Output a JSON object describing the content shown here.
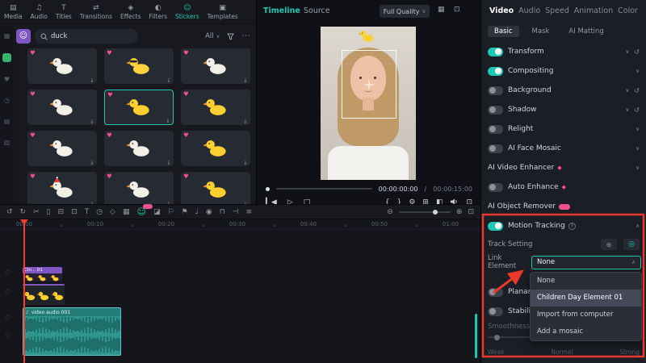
{
  "colors": {
    "accent": "#1fc8b2",
    "annotation_red": "#e8392c",
    "badge_pink": "#f0508c",
    "sticker_clip_purple": "#7e57c2",
    "audio_clip_teal": "#2f968f"
  },
  "media_toolbar": {
    "items": [
      {
        "id": "media",
        "label": "Media"
      },
      {
        "id": "audio",
        "label": "Audio"
      },
      {
        "id": "titles",
        "label": "Titles"
      },
      {
        "id": "transitions",
        "label": "Transitions"
      },
      {
        "id": "effects",
        "label": "Effects"
      },
      {
        "id": "filters",
        "label": "Filters"
      },
      {
        "id": "stickers",
        "label": "Stickers",
        "active": true
      },
      {
        "id": "templates",
        "label": "Templates"
      }
    ]
  },
  "sticker_panel": {
    "search": {
      "value": "duck"
    },
    "filter_all_label": "All",
    "more_label": "···",
    "stickers": [
      {
        "name": "white-duck",
        "color": "#f2efe6"
      },
      {
        "name": "sunglasses-duck",
        "color": "#ffd23e",
        "accessory": "sunglasses"
      },
      {
        "name": "white-duckling",
        "color": "#f2efe6"
      },
      {
        "name": "dancing-goose",
        "color": "#f2efe6"
      },
      {
        "name": "yellow-duck",
        "color": "#ffcf2f",
        "selected": true
      },
      {
        "name": "rubber-duck",
        "color": "#ffcf2f"
      },
      {
        "name": "swan-pair",
        "color": "#f2efe6"
      },
      {
        "name": "white-goose",
        "color": "#f2efe6"
      },
      {
        "name": "umbrella-duck",
        "color": "#ffcf2f"
      },
      {
        "name": "santa-duck",
        "color": "#f2efe6",
        "accessory": "hat"
      },
      {
        "name": "white-swan",
        "color": "#f2efe6"
      },
      {
        "name": "yellow-duckling",
        "color": "#ffcf2f"
      }
    ]
  },
  "preview": {
    "tabs": [
      {
        "label": "Timeline",
        "active": true
      },
      {
        "label": "Source",
        "active": false
      }
    ],
    "quality_label": "Full Quality",
    "header_icons": [
      "grid-view",
      "expand-view"
    ],
    "timecode_current": "00:00:00:00",
    "timecode_separator": "/",
    "timecode_total": "00:00:15:00",
    "player_left": [
      "skip-back",
      "play",
      "stop"
    ],
    "player_right": [
      "brace-in",
      "brace-out",
      "settings",
      "expand",
      "compare",
      "volume",
      "fullscreen"
    ]
  },
  "properties": {
    "tabs": [
      {
        "label": "Video",
        "active": true
      },
      {
        "label": "Audio"
      },
      {
        "label": "Speed"
      },
      {
        "label": "Animation"
      },
      {
        "label": "Color"
      }
    ],
    "sub_tabs": [
      {
        "label": "Basic",
        "active": true
      },
      {
        "label": "Mask"
      },
      {
        "label": "AI Matting"
      }
    ],
    "rows": [
      {
        "id": "transform",
        "label": "Transform",
        "toggle": "on",
        "chevron": true,
        "reset": true
      },
      {
        "id": "compositing",
        "label": "Compositing",
        "toggle": "on",
        "chevron": true,
        "reset": false
      },
      {
        "id": "background",
        "label": "Background",
        "toggle": "off",
        "chevron": true,
        "reset": true
      },
      {
        "id": "shadow",
        "label": "Shadow",
        "toggle": "off",
        "chevron": true,
        "reset": true
      },
      {
        "id": "relight",
        "label": "Relight",
        "toggle": "off",
        "chevron": true,
        "reset": false
      },
      {
        "id": "ai-face-mosaic",
        "label": "AI Face Mosaic",
        "toggle": "off",
        "chevron": true,
        "reset": false
      },
      {
        "id": "ai-video-enhancer",
        "label": "AI Video Enhancer",
        "toggle": "none",
        "badge": "diamond",
        "chevron": true,
        "reset": false
      },
      {
        "id": "auto-enhance",
        "label": "Auto Enhance",
        "toggle": "off",
        "badge": "diamond",
        "chevron": false,
        "reset": false
      },
      {
        "id": "ai-object-remover",
        "label": "AI Object Remover",
        "toggle": "none",
        "badge": "new",
        "chevron": false,
        "reset": false
      }
    ],
    "motion_tracking": {
      "label": "Motion Tracking",
      "toggle": "on"
    },
    "track_setting": {
      "label": "Track Setting"
    },
    "link_element": {
      "label": "Link Element",
      "value": "None"
    },
    "dropdown": {
      "options": [
        {
          "label": "None"
        },
        {
          "label": "Children Day Element 01",
          "highlighted": true
        },
        {
          "label": "Import from computer"
        },
        {
          "label": "Add a mosaic"
        }
      ]
    },
    "lower_rows": [
      {
        "id": "planar-tracking",
        "label": "Planar Tracking"
      },
      {
        "id": "stabilization",
        "label": "Stabilization"
      }
    ],
    "smoothness": {
      "label": "Smoothness",
      "ticks": [
        "Weak",
        "Normal",
        "Strong"
      ]
    }
  },
  "timeline": {
    "toolbar_icons": [
      {
        "n": "undo"
      },
      {
        "n": "redo"
      },
      {
        "n": "scissors"
      },
      {
        "n": "split"
      },
      {
        "n": "trash"
      },
      {
        "n": "crop"
      },
      {
        "n": "text"
      },
      {
        "n": "timer"
      },
      {
        "n": "keyframe"
      },
      {
        "n": "grid"
      },
      {
        "n": "sticker",
        "accent": true,
        "badge": true
      },
      {
        "n": "mask"
      },
      {
        "n": "flag"
      },
      {
        "n": "marker"
      },
      {
        "n": "mic"
      },
      {
        "n": "record"
      },
      {
        "n": "magnet"
      },
      {
        "n": "snap"
      },
      {
        "n": "tracks"
      }
    ],
    "zoom_icons": [
      "zoom-out",
      "zoom-in",
      "fit"
    ],
    "ruler_labels": [
      "00:00",
      "00:10",
      "00:20",
      "00:30",
      "00:40",
      "00:50",
      "01:00"
    ],
    "clips": [
      {
        "id": "sticker-clip",
        "label": "Chi... 01"
      },
      {
        "id": "duck-video-clip"
      },
      {
        "id": "audio-clip",
        "label": "video audio 001"
      }
    ]
  }
}
